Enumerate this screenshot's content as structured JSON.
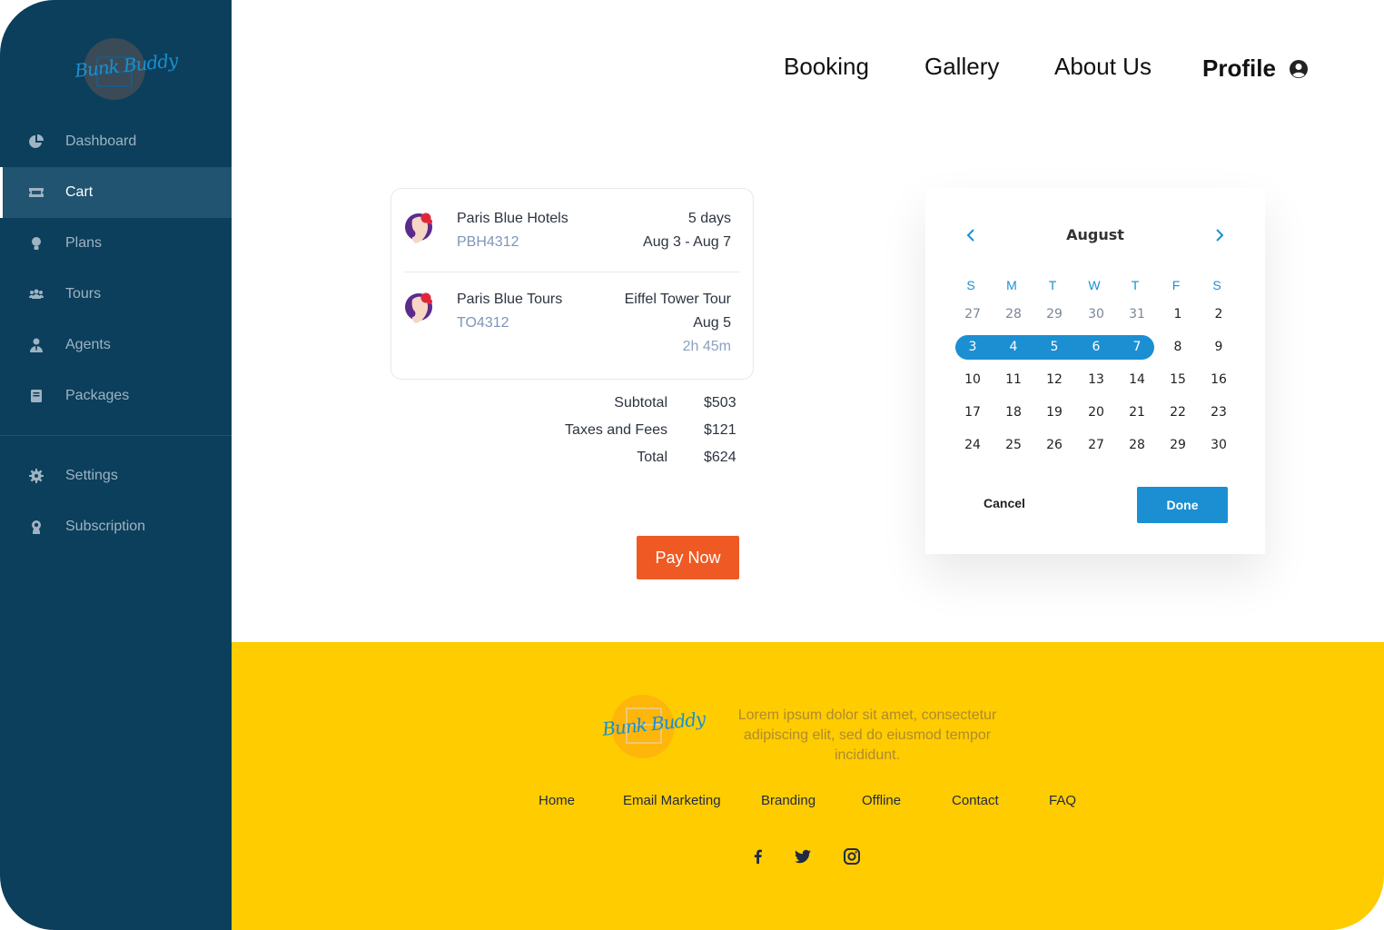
{
  "brand": {
    "logo_text": "Bunk Buddy"
  },
  "sidebar": {
    "items": [
      {
        "label": "Dashboard",
        "icon": "pie-chart-icon"
      },
      {
        "label": "Cart",
        "icon": "ticket-icon",
        "active": true
      },
      {
        "label": "Plans",
        "icon": "lightbulb-icon"
      },
      {
        "label": "Tours",
        "icon": "group-icon"
      },
      {
        "label": "Agents",
        "icon": "user-tie-icon"
      },
      {
        "label": "Packages",
        "icon": "book-icon"
      }
    ],
    "secondary": [
      {
        "label": "Settings",
        "icon": "gear-icon"
      },
      {
        "label": "Subscription",
        "icon": "badge-icon"
      }
    ]
  },
  "topnav": {
    "links": [
      "Booking",
      "Gallery",
      "About Us"
    ],
    "profile_label": "Profile"
  },
  "cart": {
    "items": [
      {
        "name": "Paris Blue Hotels",
        "code": "PBH4312",
        "right_line1": "5 days",
        "right_line2": "Aug 3 - Aug 7"
      },
      {
        "name": "Paris Blue Tours",
        "code": "TO4312",
        "right_line1": "Eiffel Tower Tour",
        "right_line2": "Aug 5",
        "right_line3": "2h 45m"
      }
    ],
    "summary": [
      {
        "label": "Subtotal",
        "value": "$503"
      },
      {
        "label": "Taxes and Fees",
        "value": "$121"
      },
      {
        "label": "Total",
        "value": "$624"
      }
    ],
    "pay_label": "Pay Now"
  },
  "calendar": {
    "month": "August",
    "weekdays": [
      "S",
      "M",
      "T",
      "W",
      "T",
      "F",
      "S"
    ],
    "weeks": [
      [
        "27",
        "28",
        "29",
        "30",
        "31",
        "1",
        "2"
      ],
      [
        "3",
        "4",
        "5",
        "6",
        "7",
        "8",
        "9"
      ],
      [
        "10",
        "11",
        "12",
        "13",
        "14",
        "15",
        "16"
      ],
      [
        "17",
        "18",
        "19",
        "20",
        "21",
        "22",
        "23"
      ],
      [
        "24",
        "25",
        "26",
        "27",
        "28",
        "29",
        "30"
      ]
    ],
    "selected_range": [
      "3",
      "7"
    ],
    "cancel_label": "Cancel",
    "done_label": "Done",
    "accent_color": "#1b8fd2"
  },
  "footer": {
    "description": "Lorem ipsum dolor sit amet, consectetur adipiscing elit, sed do eiusmod tempor incididunt.",
    "links": [
      "Home",
      "Email Marketing",
      "Branding",
      "Offline",
      "Contact",
      "FAQ"
    ],
    "social": [
      "facebook-icon",
      "twitter-icon",
      "instagram-icon"
    ],
    "background_color": "#ffcc00"
  },
  "colors": {
    "sidebar": "#0b3f5c",
    "pay_button": "#ef5a24"
  }
}
